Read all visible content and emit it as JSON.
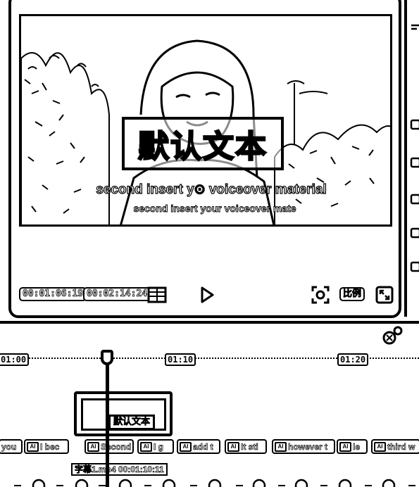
{
  "preview": {
    "title_text": "默认文本",
    "caption_primary": "second insert y⊙ voiceover material",
    "caption_secondary": "second insert your voiceover mate"
  },
  "player": {
    "current_time": "00:01:06:19",
    "total_time": "00:02:14:24",
    "ratio_label": "比例"
  },
  "timeline": {
    "ruler_labels": [
      "01:00",
      "01:10",
      "01:20"
    ],
    "overlay_text_chip": "默认文本",
    "text_clips": [
      {
        "label": "you"
      },
      {
        "label": "I bec"
      },
      {
        "label": "Second"
      },
      {
        "label": "I g"
      },
      {
        "label": "add t"
      },
      {
        "label": "It sti"
      },
      {
        "label": "however t"
      },
      {
        "label": "le"
      },
      {
        "label": "third w"
      }
    ],
    "main_track_label": "字幕1.mp4   00:01:10:11"
  },
  "icons": {
    "list": "list-icon",
    "play": "play-icon",
    "snapshot": "camera-snapshot-icon",
    "fullscreen": "fullscreen-icon",
    "magic": "magic-wand-icon",
    "text_clip": "text-clip-icon"
  }
}
